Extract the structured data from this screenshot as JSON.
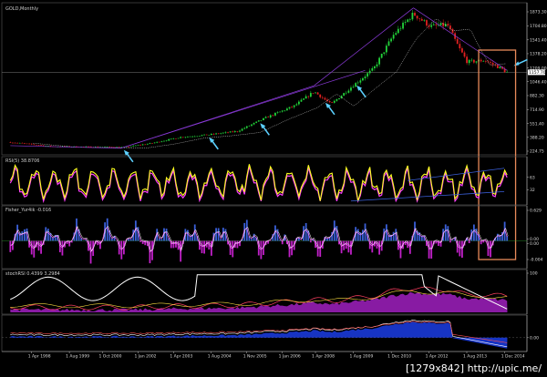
{
  "watermark": "[1279x842] http://upic.me/",
  "colors": {
    "background": "#000000",
    "bull": "#22d33a",
    "bear": "#e02020",
    "rsi": "#ffff20",
    "rsi_shadow": "#ff40ff",
    "fisher_up": "#3a5fd8",
    "fisher_down": "#c020c8",
    "fisher_line": "#ffffff",
    "trend": "#8a3ad8",
    "arrow": "#5cd0ff",
    "highlight": "#e88a5a",
    "grid": "#5a5a5a"
  },
  "chart_data": [
    {
      "type": "candlestick",
      "title": "GOLD,Monthly",
      "y_ticks": [
        "1873.30",
        "1704.80",
        "1541.40",
        "1378.20",
        "1209.00",
        "1046.40",
        "882.30",
        "714.90",
        "551.40",
        "388.20",
        "224.75"
      ],
      "current_price": "1157.70",
      "ylim": [
        224.75,
        1873.3
      ],
      "x_ticks": [
        "1 Apr 1998",
        "1 Aug 1999",
        "1 Oct 2000",
        "1 Jan 2002",
        "1 Apr 2003",
        "1 Aug 2004",
        "1 Nov 2005",
        "1 Jan 2006",
        "1 Apr 2008",
        "1 Aug 2009",
        "1 Dec 2010",
        "1 Apr 2012",
        "1 Aug 2013",
        "1 Dec 2014"
      ],
      "x_tick_years": [
        1998.25,
        1999.58,
        2000.75,
        2002.0,
        2003.25,
        2004.58,
        2005.83,
        2007.08,
        2008.25,
        2009.58,
        2010.92,
        2012.25,
        2013.58,
        2014.92
      ],
      "xlim": [
        1997.2,
        2015.7
      ],
      "close_path": [
        [
          1997.5,
          330
        ],
        [
          1999.0,
          280
        ],
        [
          2000.5,
          275
        ],
        [
          2001.5,
          270
        ],
        [
          2002.5,
          320
        ],
        [
          2003.5,
          390
        ],
        [
          2004.5,
          420
        ],
        [
          2005.5,
          460
        ],
        [
          2006.5,
          620
        ],
        [
          2007.5,
          760
        ],
        [
          2008.2,
          930
        ],
        [
          2008.8,
          780
        ],
        [
          2009.5,
          980
        ],
        [
          2010.3,
          1200
        ],
        [
          2011.0,
          1600
        ],
        [
          2011.7,
          1850
        ],
        [
          2012.3,
          1700
        ],
        [
          2012.9,
          1720
        ],
        [
          2013.3,
          1450
        ],
        [
          2013.6,
          1280
        ],
        [
          2014.2,
          1300
        ],
        [
          2014.7,
          1220
        ],
        [
          2015.0,
          1157.7
        ]
      ],
      "trendlines": [
        {
          "from": [
            1997.5,
            290
          ],
          "to": [
            2001.4,
            260
          ]
        },
        {
          "from": [
            2001.4,
            260
          ],
          "to": [
            2008.2,
            1000
          ]
        },
        {
          "from": [
            2008.2,
            1000
          ],
          "to": [
            2011.7,
            1920
          ]
        },
        {
          "from": [
            2011.7,
            1920
          ],
          "to": [
            2015.0,
            1180
          ]
        },
        {
          "from": [
            2001.4,
            260
          ],
          "to": [
            2010.0,
            1180
          ]
        }
      ],
      "arrows": [
        2001.5,
        2004.5,
        2006.3,
        2008.6,
        2009.7,
        2015.2
      ],
      "highlight_years": [
        2014.0,
        2015.3
      ]
    },
    {
      "type": "line",
      "title": "RSI(5) 38.8706",
      "y_ticks": [
        "63",
        "32"
      ],
      "ylim": [
        0,
        100
      ]
    },
    {
      "type": "bar",
      "title": "Fisher_Yur4ik -0.016",
      "y_ticks": [
        "0.629",
        "0.00",
        "0.00",
        "-0.004"
      ],
      "ylim": [
        -1,
        1
      ]
    },
    {
      "type": "area",
      "title": "stochRSI 0.4399 3.2984",
      "y_ticks": [
        "100"
      ],
      "ylim": [
        0,
        100
      ]
    },
    {
      "type": "area",
      "title": "",
      "y_ticks": [
        "0.00"
      ],
      "ylim": [
        -1,
        1
      ]
    }
  ]
}
